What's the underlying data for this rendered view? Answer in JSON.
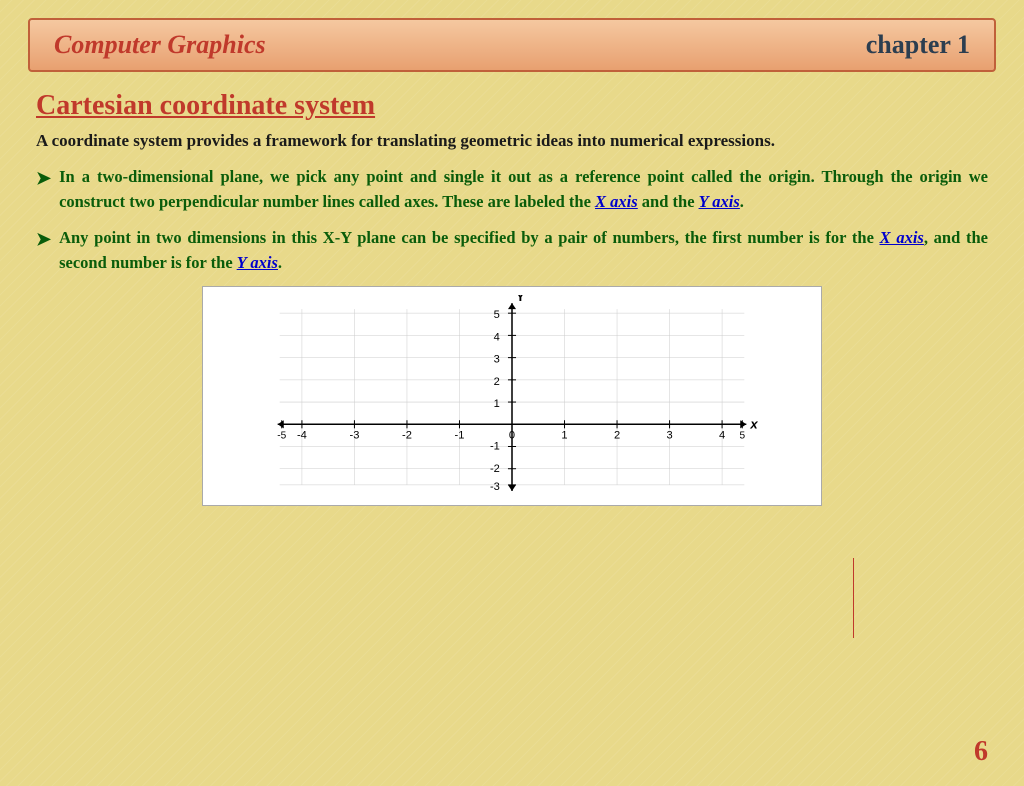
{
  "header": {
    "title": "Computer Graphics",
    "chapter": "chapter 1"
  },
  "section": {
    "title": "Cartesian coordinate system",
    "intro": "A coordinate system provides a framework for translating geometric ideas into numerical expressions.",
    "bullets": [
      {
        "text_before": "In a two-dimensional plane, we pick any point and single it out as a reference point called the origin. Through the origin we construct two perpendicular number lines called axes. These are labeled the ",
        "link1": "X axis",
        "text_middle": " and the ",
        "link2": "Y axis",
        "text_after": "."
      },
      {
        "text_before": "Any point in two dimensions in this X-Y plane can be specified by a pair of numbers, the first number is for the ",
        "link1": "X axis",
        "text_middle": ", and the second number is for the ",
        "link2": "Y axis",
        "text_after": "."
      }
    ]
  },
  "page_number": "6",
  "chart": {
    "x_label": "x",
    "y_label": "Y",
    "x_range": [
      -5,
      5
    ],
    "y_range": [
      -3,
      5
    ]
  }
}
